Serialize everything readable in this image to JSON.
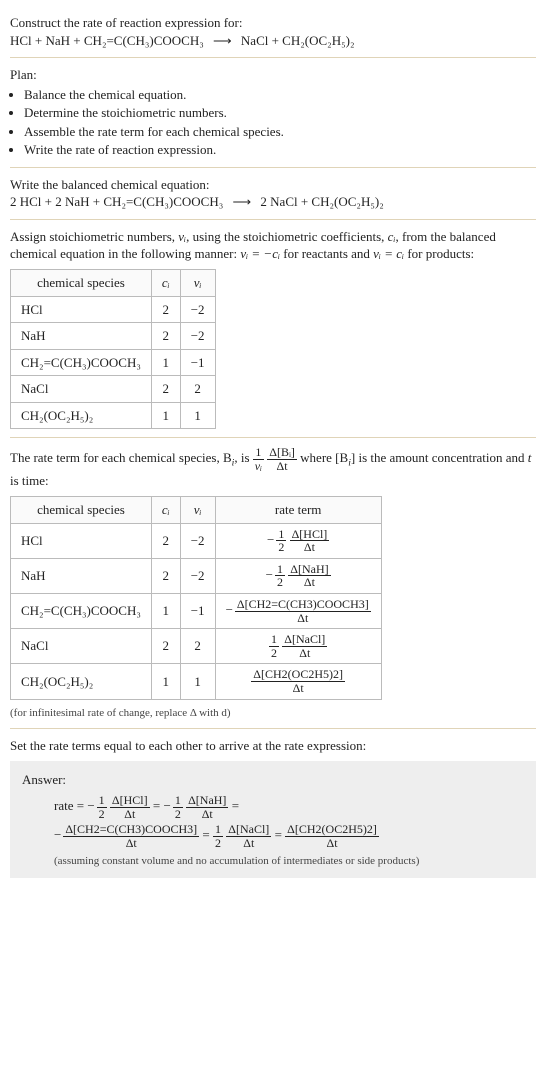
{
  "prompt": {
    "lead": "Construct the rate of reaction expression for:",
    "reaction_lhs": "HCl + NaH + CH₂=C(CH₃)COOCH₃",
    "arrow": "⟶",
    "reaction_rhs": "NaCl + CH₂(OC₂H₅)₂"
  },
  "plan": {
    "head": "Plan:",
    "items": [
      "Balance the chemical equation.",
      "Determine the stoichiometric numbers.",
      "Assemble the rate term for each chemical species.",
      "Write the rate of reaction expression."
    ]
  },
  "balanced": {
    "head": "Write the balanced chemical equation:",
    "lhs": "2 HCl + 2 NaH + CH₂=C(CH₃)COOCH₃",
    "arrow": "⟶",
    "rhs": "2 NaCl + CH₂(OC₂H₅)₂"
  },
  "assign_text": {
    "p1a": "Assign stoichiometric numbers, ",
    "p1b": ", using the stoichiometric coefficients, ",
    "p1c": ", from the balanced chemical equation in the following manner: ",
    "p1d": " for reactants and ",
    "p1e": " for products:",
    "nu": "νᵢ",
    "ci": "cᵢ",
    "eq1": "νᵢ = −cᵢ",
    "eq2": "νᵢ = cᵢ"
  },
  "table1": {
    "headers": [
      "chemical species",
      "cᵢ",
      "νᵢ"
    ],
    "rows": [
      [
        "HCl",
        "2",
        "−2"
      ],
      [
        "NaH",
        "2",
        "−2"
      ],
      [
        "CH₂=C(CH₃)COOCH₃",
        "1",
        "−1"
      ],
      [
        "NaCl",
        "2",
        "2"
      ],
      [
        "CH₂(OC₂H₅)₂",
        "1",
        "1"
      ]
    ]
  },
  "rate_term_text": {
    "a": "The rate term for each chemical species, B",
    "b": ", is ",
    "c": " where [B",
    "d": "] is the amount concentration and ",
    "e": " is time:",
    "i": "i",
    "t": "t",
    "frac1_num": "1",
    "frac1_den": "νᵢ",
    "frac2_num": "Δ[Bᵢ]",
    "frac2_den": "Δt"
  },
  "table2": {
    "headers": [
      "chemical species",
      "cᵢ",
      "νᵢ",
      "rate term"
    ],
    "rows": [
      {
        "sp": "HCl",
        "c": "2",
        "nu": "−2",
        "neg": true,
        "coef_num": "1",
        "coef_den": "2",
        "conc": "Δ[HCl]"
      },
      {
        "sp": "NaH",
        "c": "2",
        "nu": "−2",
        "neg": true,
        "coef_num": "1",
        "coef_den": "2",
        "conc": "Δ[NaH]"
      },
      {
        "sp": "CH₂=C(CH₃)COOCH₃",
        "c": "1",
        "nu": "−1",
        "neg": true,
        "coef_num": "",
        "coef_den": "",
        "conc": "Δ[CH2=C(CH3)COOCH3]"
      },
      {
        "sp": "NaCl",
        "c": "2",
        "nu": "2",
        "neg": false,
        "coef_num": "1",
        "coef_den": "2",
        "conc": "Δ[NaCl]"
      },
      {
        "sp": "CH₂(OC₂H₅)₂",
        "c": "1",
        "nu": "1",
        "neg": false,
        "coef_num": "",
        "coef_den": "",
        "conc": "Δ[CH2(OC2H5)2]"
      }
    ],
    "dt": "Δt"
  },
  "inf_note": "(for infinitesimal rate of change, replace Δ with d)",
  "set_equal": "Set the rate terms equal to each other to arrive at the rate expression:",
  "answer": {
    "label": "Answer:",
    "rate": "rate",
    "terms": [
      {
        "neg": true,
        "coef_num": "1",
        "coef_den": "2",
        "conc": "Δ[HCl]",
        "dt": "Δt"
      },
      {
        "neg": true,
        "coef_num": "1",
        "coef_den": "2",
        "conc": "Δ[NaH]",
        "dt": "Δt"
      },
      {
        "neg": true,
        "coef_num": "",
        "coef_den": "",
        "conc": "Δ[CH2=C(CH3)COOCH3]",
        "dt": "Δt"
      },
      {
        "neg": false,
        "coef_num": "1",
        "coef_den": "2",
        "conc": "Δ[NaCl]",
        "dt": "Δt"
      },
      {
        "neg": false,
        "coef_num": "",
        "coef_den": "",
        "conc": "Δ[CH2(OC2H5)2]",
        "dt": "Δt"
      }
    ],
    "note": "(assuming constant volume and no accumulation of intermediates or side products)"
  },
  "chart_data": {
    "type": "table",
    "title": "Stoichiometric numbers and rate terms",
    "tables": [
      {
        "columns": [
          "chemical species",
          "c_i",
          "nu_i"
        ],
        "rows": [
          [
            "HCl",
            2,
            -2
          ],
          [
            "NaH",
            2,
            -2
          ],
          [
            "CH2=C(CH3)COOCH3",
            1,
            -1
          ],
          [
            "NaCl",
            2,
            2
          ],
          [
            "CH2(OC2H5)2",
            1,
            1
          ]
        ]
      },
      {
        "columns": [
          "chemical species",
          "c_i",
          "nu_i",
          "rate term"
        ],
        "rows": [
          [
            "HCl",
            2,
            -2,
            "-(1/2) d[HCl]/dt"
          ],
          [
            "NaH",
            2,
            -2,
            "-(1/2) d[NaH]/dt"
          ],
          [
            "CH2=C(CH3)COOCH3",
            1,
            -1,
            "- d[CH2=C(CH3)COOCH3]/dt"
          ],
          [
            "NaCl",
            2,
            2,
            "(1/2) d[NaCl]/dt"
          ],
          [
            "CH2(OC2H5)2",
            1,
            1,
            "d[CH2(OC2H5)2]/dt"
          ]
        ]
      }
    ]
  }
}
